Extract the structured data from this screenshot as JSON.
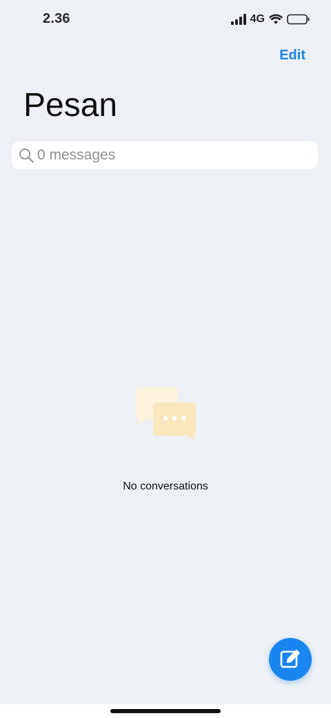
{
  "status_bar": {
    "time": "2.36",
    "network": "4G",
    "icons": [
      "signal-icon",
      "wifi-icon",
      "battery-icon"
    ]
  },
  "header": {
    "edit_label": "Edit",
    "title": "Pesan"
  },
  "search": {
    "placeholder": "0 messages",
    "value": ""
  },
  "empty_state": {
    "text": "No conversations",
    "icon": "chat-bubbles-icon"
  },
  "fab": {
    "icon": "compose-icon"
  },
  "colors": {
    "background": "#edf0f4",
    "accent": "#1a85e8",
    "search_bg": "#ffffff",
    "illustration_front": "#f8e6bf",
    "illustration_back": "#fdf3de"
  }
}
